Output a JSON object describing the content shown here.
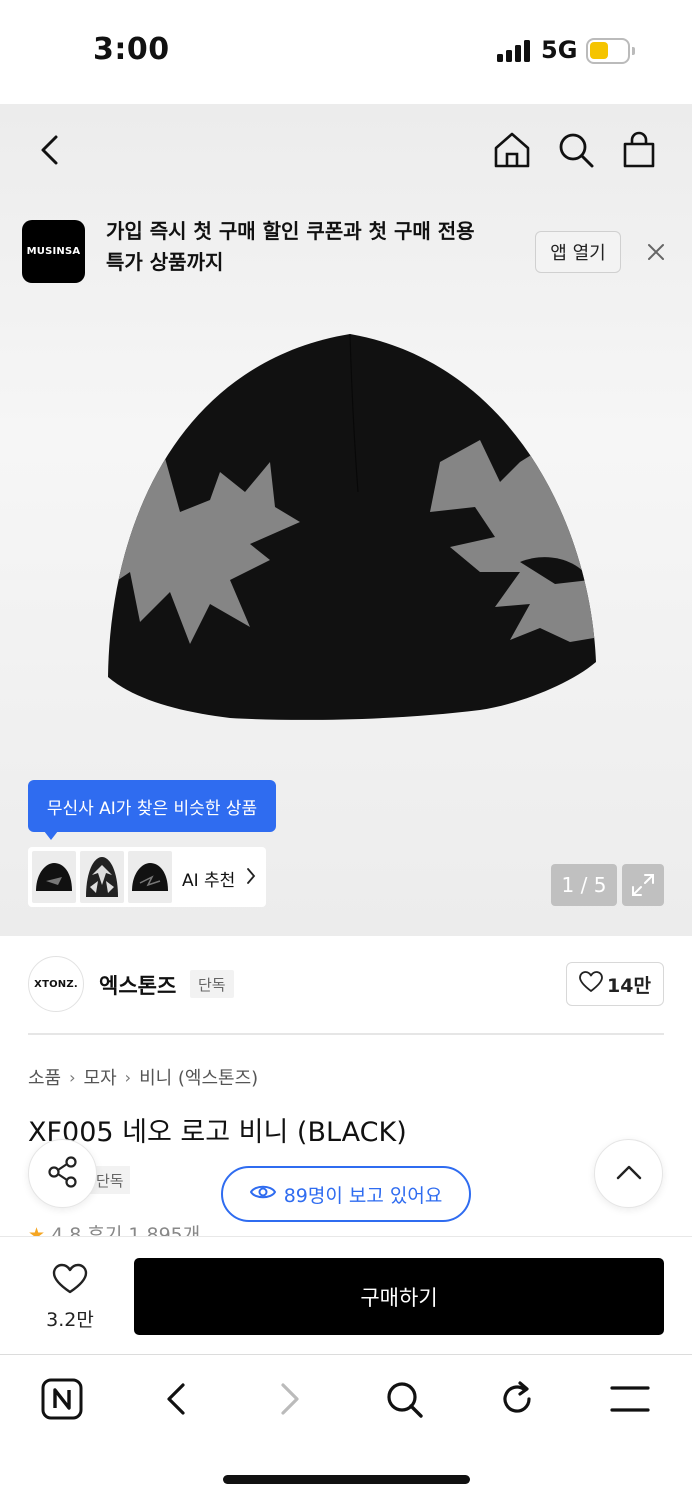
{
  "status_bar": {
    "time": "3:00",
    "network": "5G",
    "battery_color": "#f5c400"
  },
  "nav": {
    "icons": [
      "back-icon",
      "home-icon",
      "search-icon",
      "shopping-bag-icon"
    ]
  },
  "banner": {
    "logo_text": "MUSINSA",
    "text": "가입 즉시 첫 구매 할인 쿠폰과 첫 구매 전용 특가 상품까지",
    "open_app_label": "앱 열기"
  },
  "gallery": {
    "ai_tooltip": "무신사 AI가 찾은 비슷한 상품",
    "ai_recommend_label": "AI 추천",
    "page_counter": "1 / 5"
  },
  "brand": {
    "logo_text": "XTONZ.",
    "name": "엑스톤즈",
    "badge": "단독",
    "likes": "14만"
  },
  "breadcrumb": [
    "소품",
    "모자",
    "비니 (엑스톤즈)"
  ],
  "product": {
    "title": "XF005 네오 로고 비니 (BLACK)",
    "badge_partial": "단독",
    "rating_peek": "4.8  후기 1,895개",
    "viewers": "89명이 보고 있어요"
  },
  "purchase": {
    "wish_count": "3.2만",
    "buy_label": "구매하기"
  },
  "browser": {
    "icons": [
      "n-home-icon",
      "back-arrow-icon",
      "forward-arrow-icon",
      "search-icon",
      "refresh-icon",
      "menu-icon"
    ]
  },
  "colors": {
    "accent_blue": "#2f6cf0",
    "buy_button": "#000000",
    "star": "#f5a623"
  }
}
